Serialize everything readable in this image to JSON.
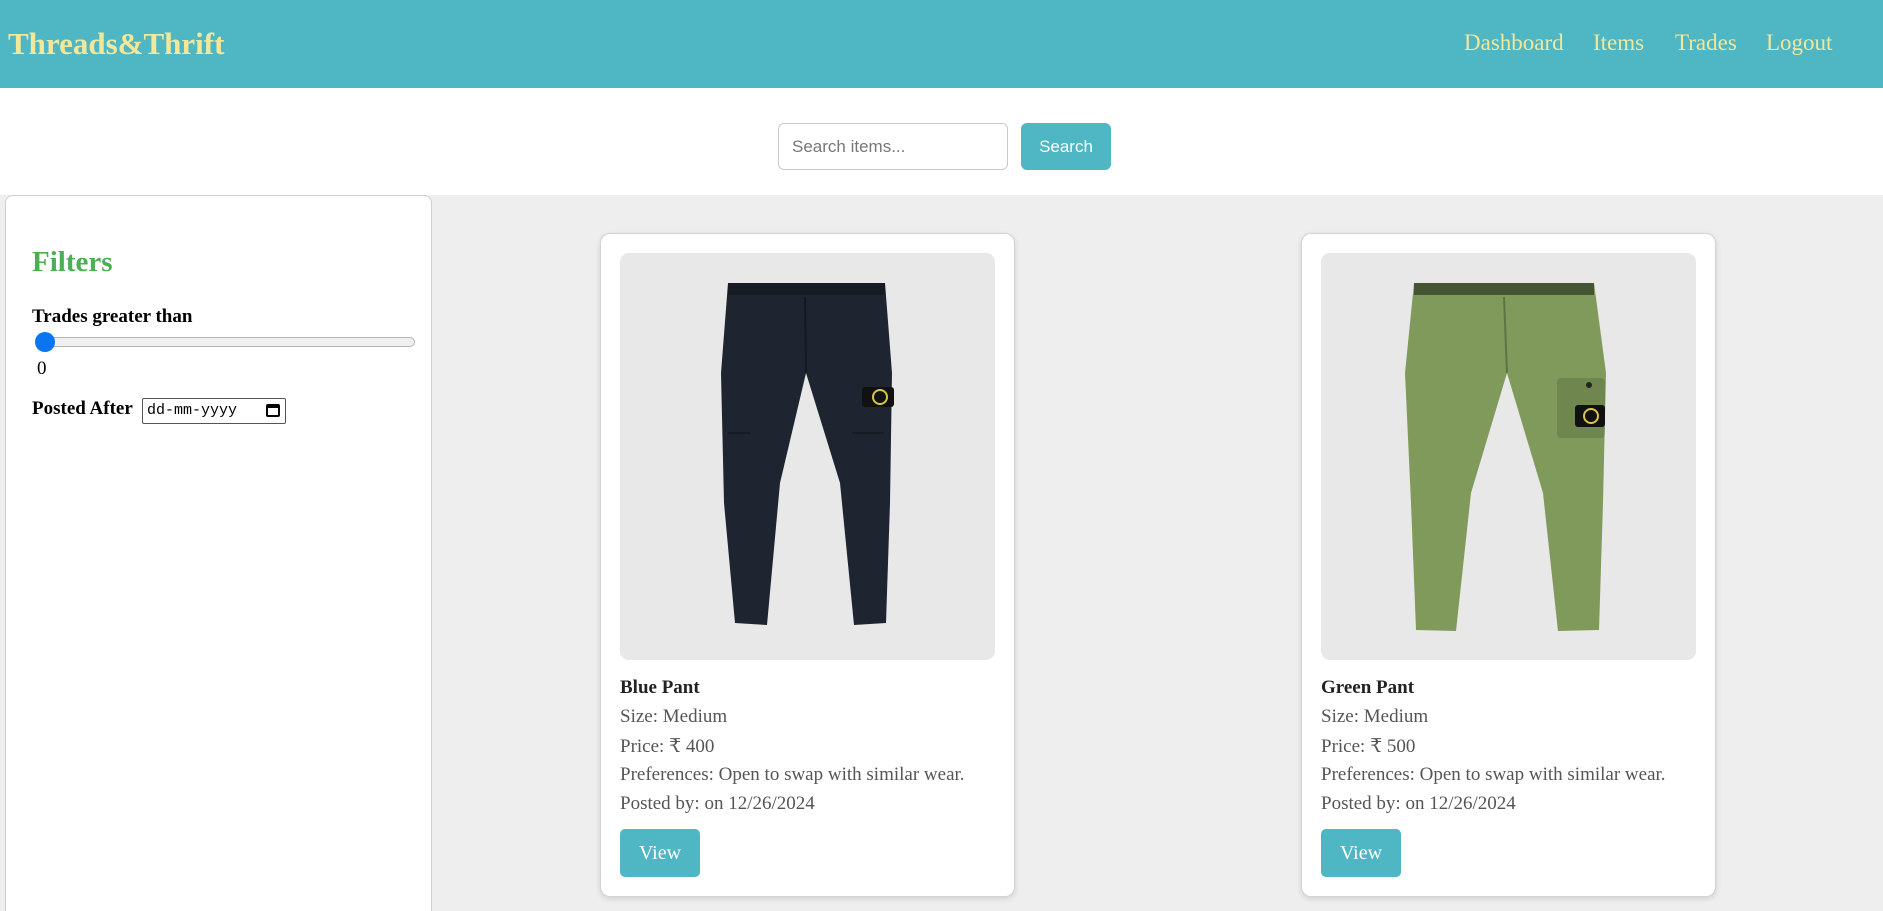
{
  "navbar": {
    "brand": "Threads&Thrift",
    "links": [
      "Dashboard",
      "Items",
      "Trades",
      "Logout"
    ]
  },
  "search": {
    "placeholder": "Search items...",
    "value": "",
    "button_label": "Search"
  },
  "filters": {
    "title": "Filters",
    "trades_label": "Trades greater than",
    "trades_value": "0",
    "posted_after_label": "Posted After",
    "date_placeholder": "dd-mm-yyyy"
  },
  "items": [
    {
      "name": "Blue Pant",
      "size": "Size: Medium",
      "price": "Price: ₹ 400",
      "preferences": "Preferences: Open to swap with similar wear.",
      "posted": "Posted by: on 12/26/2024",
      "view_label": "View",
      "pant_color": "#1e2530",
      "image_icon": "navy-cargo-pant"
    },
    {
      "name": "Green Pant",
      "size": "Size: Medium",
      "price": "Price: ₹ 500",
      "preferences": "Preferences: Open to swap with similar wear.",
      "posted": "Posted by: on 12/26/2024",
      "view_label": "View",
      "pant_color": "#7f9a5b",
      "image_icon": "olive-cargo-pant"
    }
  ],
  "colors": {
    "navbar_bg": "#4fb6c4",
    "brand_text": "#f3e79a",
    "filters_title": "#4caf50",
    "slider_thumb": "#0a74f2",
    "content_bg": "#eeeeee"
  }
}
